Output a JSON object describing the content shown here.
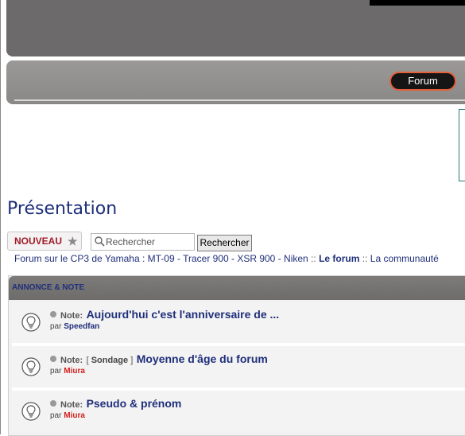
{
  "navbar": {
    "forum_label": "Forum"
  },
  "page": {
    "title": "Présentation"
  },
  "toolbar": {
    "new_label": "NOUVEAU",
    "new_star": "★",
    "search_placeholder": "Rechercher",
    "search_button": "Rechercher"
  },
  "breadcrumb": {
    "home": "Forum sur le CP3 de Yamaha : MT-09 - Tracer 900 - XSR 900 - Niken",
    "sep1": "::",
    "forum": "Le forum",
    "sep2": "::",
    "community": "La communauté"
  },
  "section": {
    "title": "ANNONCE & NOTE"
  },
  "topics": [
    {
      "prefix": "Note:",
      "tag": "",
      "title": "Aujourd'hui c'est l'anniversaire de ...",
      "by": "par",
      "author": "Speedfan",
      "author_color": "#1f2f7a"
    },
    {
      "prefix": "Note:",
      "tag": "Sondage",
      "title": "Moyenne d'âge du forum",
      "by": "par",
      "author": "Miura",
      "author_color": "#d42020"
    },
    {
      "prefix": "Note:",
      "tag": "",
      "title": "Pseudo & prénom",
      "by": "par",
      "author": "Miura",
      "author_color": "#d42020"
    }
  ]
}
